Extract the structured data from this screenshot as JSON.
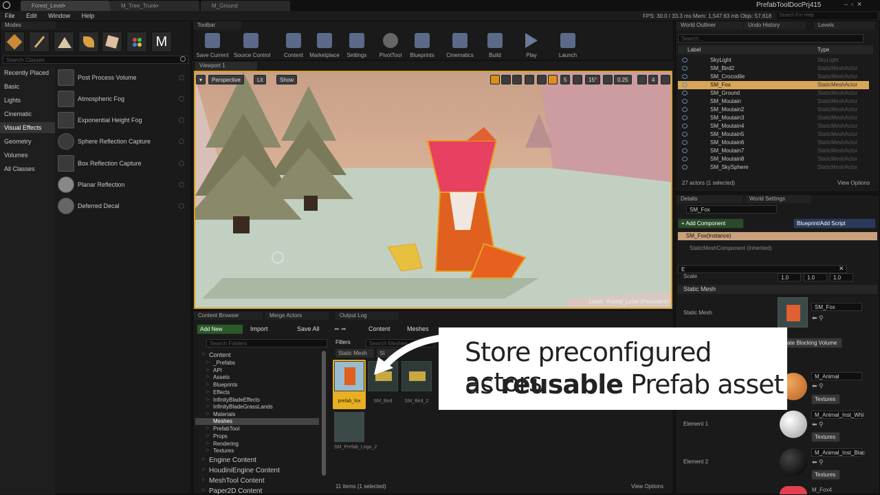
{
  "titlebar": {
    "tabs": [
      "Forest_Level•",
      "M_Tree_Trunk•",
      "M_Ground"
    ],
    "project": "PrefabToolDocPrj415"
  },
  "menubar": [
    "File",
    "Edit",
    "Window",
    "Help"
  ],
  "stats": {
    "fps": "FPS: 30.0 / 33.3 ms Mem: 1,547.63 mb Objs: 57,618",
    "help_search": "Search For Help"
  },
  "modes": {
    "tab": "Modes",
    "search_placeholder": "Search Classes",
    "categories": [
      "Recently Placed",
      "Basic",
      "Lights",
      "Cinematic",
      "Visual Effects",
      "Geometry",
      "Volumes",
      "All Classes"
    ],
    "items": [
      "Post Process Volume",
      "Atmospheric Fog",
      "Exponential Height Fog",
      "Sphere Reflection Capture",
      "Box Reflection Capture",
      "Planar Reflection",
      "Deferred Decal"
    ]
  },
  "toolbar": {
    "tab": "Toolbar",
    "buttons": [
      "Save Current",
      "Source Control",
      "Content",
      "Marketplace",
      "Settings",
      "PivotTool",
      "Blueprints",
      "Cinematics",
      "Build",
      "Play",
      "Launch"
    ]
  },
  "viewport": {
    "tab": "Viewport 1",
    "perspective": "Perspective",
    "lit": "Lit",
    "show": "Show",
    "grid": "5",
    "angle": "15°",
    "scale": "0.25",
    "speed": "4",
    "level_label": "Level:",
    "level_name": "Forest_Level (Persistent)"
  },
  "outliner": {
    "tabs": [
      "World Outliner",
      "Undo History",
      "Levels"
    ],
    "search_placeholder": "Search...",
    "col_label": "Label",
    "col_type": "Type",
    "rows": [
      [
        "SkyLight",
        "SkyLight"
      ],
      [
        "SM_Bird2",
        "StaticMeshActor"
      ],
      [
        "SM_Crocodile",
        "StaticMeshActor"
      ],
      [
        "SM_Fox",
        "StaticMeshActor"
      ],
      [
        "SM_Ground",
        "StaticMeshActor"
      ],
      [
        "SM_Moutain",
        "StaticMeshActor"
      ],
      [
        "SM_Moutain2",
        "StaticMeshActor"
      ],
      [
        "SM_Moutain3",
        "StaticMeshActor"
      ],
      [
        "SM_Moutain4",
        "StaticMeshActor"
      ],
      [
        "SM_Moutain5",
        "StaticMeshActor"
      ],
      [
        "SM_Moutain6",
        "StaticMeshActor"
      ],
      [
        "SM_Moutain7",
        "StaticMeshActor"
      ],
      [
        "SM_Moutain8",
        "StaticMeshActor"
      ],
      [
        "SM_SkySphere",
        "StaticMeshActor"
      ]
    ],
    "footer": "27 actors (1 selected)",
    "view_options": "View Options"
  },
  "details": {
    "tabs": [
      "Details",
      "World Settings"
    ],
    "name": "SM_Fox",
    "add_component": "+ Add Component",
    "blueprint": "Blueprint/Add Script",
    "instance": "SM_Fox(Instance)",
    "component": "StaticMeshComponent (Inherited)",
    "filter": "E",
    "scale_label": "Scale",
    "scale": [
      "1.0",
      "1.0",
      "1.0"
    ],
    "section": "Static Mesh",
    "static_mesh_label": "Static Mesh",
    "mesh_name": "SM_Fox",
    "blocking_btn": "ate Blocking Volume",
    "materials": [
      {
        "label": "",
        "name": "M_Animal"
      },
      {
        "label": "Element 1",
        "name": "M_Animal_Inst_Whi"
      },
      {
        "label": "Element 2",
        "name": "M_Animal_Inst_Blac"
      }
    ],
    "textures": "Textures",
    "last_mat": "M_Fox4"
  },
  "content_browser": {
    "tabs": [
      "Content Browser",
      "Merge Actors",
      "Output Log"
    ],
    "add_new": "Add New",
    "import": "Import",
    "save_all": "Save All",
    "folders_placeholder": "Search Folders",
    "path": [
      "Content",
      "Meshes"
    ],
    "filters": "Filters",
    "search_placeholder": "Search Meshes",
    "filter_chip": "Static Mesh",
    "filter_chip2": "St",
    "tree": [
      "Content",
      "_Prefabs",
      "API",
      "Assets",
      "Blueprints",
      "Effects",
      "InfinityBladeEffects",
      "InfinityBladeGrassLands",
      "Materials",
      "Meshes",
      "PrefabTool",
      "Props",
      "Rendering",
      "Textures"
    ],
    "roots": [
      "Engine Content",
      "HoudiniEngine Content",
      "MeshTool Content",
      "Paper2D Content"
    ],
    "assets": [
      "prefab_fox",
      "SM_Bird",
      "SM_Bird_2",
      "SM_Prefab_Logo_2"
    ],
    "footer": "11 items (1 selected)",
    "view_options": "View Options"
  },
  "callout": {
    "line1": "Store preconfigured actors",
    "line2_pre": "as ",
    "line2_bold": "reusable",
    "line2_post": " Prefab asset"
  }
}
